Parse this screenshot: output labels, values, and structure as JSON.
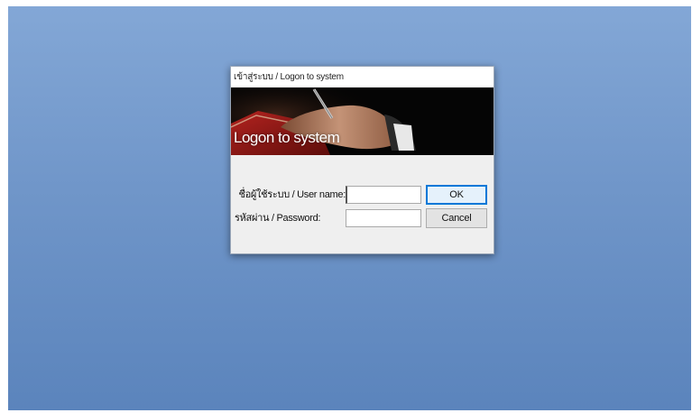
{
  "dialog": {
    "title": "เข้าสู่ระบบ / Logon to system",
    "banner_text": "Logon to system",
    "username_label": "ชื่อผู้ใช้ระบบ / User name:",
    "username_value": "",
    "password_label": "รหัสผ่าน / Password:",
    "password_value": "",
    "ok_label": "OK",
    "cancel_label": "Cancel"
  },
  "colors": {
    "desktop_top": "#83a7d6",
    "desktop_bottom": "#5b84bc",
    "default_button_border": "#0078d7"
  }
}
